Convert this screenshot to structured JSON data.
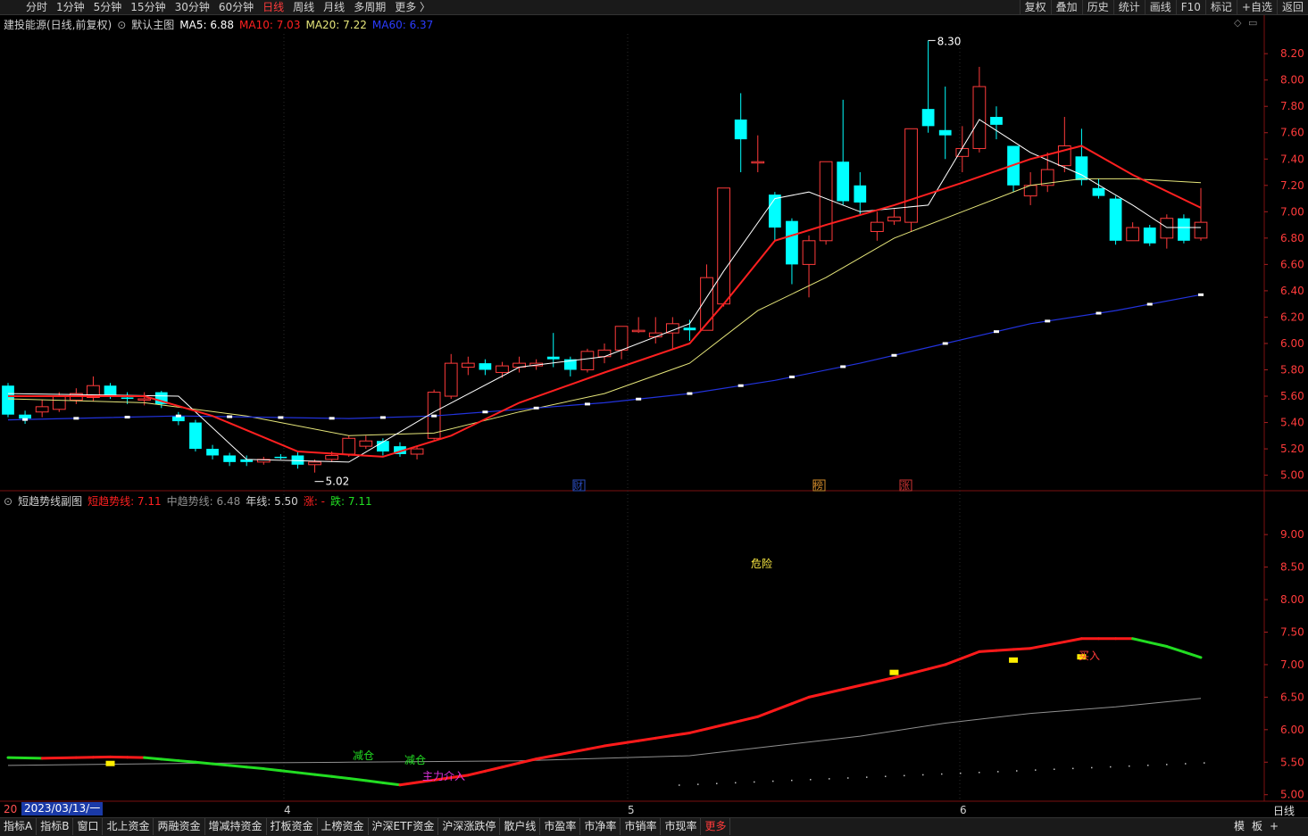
{
  "toolbar_left": [
    "分时",
    "1分钟",
    "5分钟",
    "15分钟",
    "30分钟",
    "60分钟",
    "日线",
    "周线",
    "月线",
    "多周期",
    "更多 〉"
  ],
  "toolbar_active": "日线",
  "toolbar_right": [
    "复权",
    "叠加",
    "历史",
    "统计",
    "画线",
    "F10",
    "标记",
    "+自选",
    "返回"
  ],
  "main": {
    "stock_title": "建投能源(日线,前复权)",
    "template": "默认主图",
    "ma5": "MA5: 6.88",
    "ma10": "MA10: 7.03",
    "ma20": "MA20: 7.22",
    "ma60": "MA60: 6.37",
    "y_ticks": [
      "8.20",
      "8.00",
      "7.80",
      "7.60",
      "7.40",
      "7.20",
      "7.00",
      "6.80",
      "6.60",
      "6.40",
      "6.20",
      "6.00",
      "5.80",
      "5.60",
      "5.40",
      "5.20",
      "5.00"
    ],
    "high_label": "8.30",
    "low_label": "5.02",
    "event_labels": [
      "财",
      "榜",
      "涨"
    ]
  },
  "sub": {
    "title": "短趋势线副图",
    "short_trend": "短趋势线: 7.11",
    "mid_trend": "中趋势线: 6.48",
    "year_line": "年线: 5.50",
    "up_label": "涨: -",
    "down_label": "跌: 7.11",
    "y_ticks": [
      "9.00",
      "8.50",
      "8.00",
      "7.50",
      "7.00",
      "6.50",
      "6.00",
      "5.50",
      "5.00"
    ],
    "annotations": [
      "危险",
      "减仓",
      "减仓",
      "主力介入",
      "买入"
    ]
  },
  "x_axis": {
    "date_box": "2023/03/13/一",
    "month_labels": [
      "4",
      "5",
      "6"
    ]
  },
  "bottom_tabs": [
    "指标A",
    "指标B",
    "窗口",
    "北上资金",
    "两融资金",
    "增减持资金",
    "打板资金",
    "上榜资金",
    "沪深ETF资金",
    "沪深涨跌停",
    "散户线",
    "市盈率",
    "市净率",
    "市销率",
    "市现率",
    "更多"
  ],
  "bottom_right": [
    "模",
    "板",
    "+"
  ],
  "period_label": "日线",
  "colors": {
    "up": "#ff3b3b",
    "down": "#00ffff",
    "ma5": "#ffffff",
    "ma10": "#ff2020",
    "ma20": "#e6e67a",
    "ma60": "#2233dd",
    "trend_up": "#ff1a1a",
    "trend_down": "#22dd22",
    "mid": "#909090"
  },
  "chart_data": {
    "type": "candlestick",
    "y_range": [
      4.95,
      8.35
    ],
    "candles": [
      [
        5.68,
        5.46,
        5.7,
        5.44
      ],
      [
        5.46,
        5.43,
        5.49,
        5.39
      ],
      [
        5.48,
        5.52,
        5.57,
        5.44
      ],
      [
        5.5,
        5.6,
        5.63,
        5.48
      ],
      [
        5.57,
        5.62,
        5.66,
        5.54
      ],
      [
        5.59,
        5.68,
        5.75,
        5.56
      ],
      [
        5.68,
        5.61,
        5.7,
        5.58
      ],
      [
        5.59,
        5.58,
        5.63,
        5.54
      ],
      [
        5.58,
        5.58,
        5.63,
        5.53
      ],
      [
        5.63,
        5.54,
        5.64,
        5.51
      ],
      [
        5.45,
        5.41,
        5.48,
        5.38
      ],
      [
        5.4,
        5.2,
        5.42,
        5.18
      ],
      [
        5.2,
        5.15,
        5.23,
        5.12
      ],
      [
        5.15,
        5.1,
        5.17,
        5.07
      ],
      [
        5.12,
        5.1,
        5.15,
        5.07
      ],
      [
        5.1,
        5.12,
        5.14,
        5.08
      ],
      [
        5.14,
        5.13,
        5.16,
        5.12
      ],
      [
        5.15,
        5.08,
        5.18,
        5.05
      ],
      [
        5.08,
        5.1,
        5.12,
        5.02
      ],
      [
        5.12,
        5.15,
        5.18,
        5.1
      ],
      [
        5.16,
        5.28,
        5.3,
        5.14
      ],
      [
        5.22,
        5.26,
        5.3,
        5.2
      ],
      [
        5.26,
        5.18,
        5.28,
        5.15
      ],
      [
        5.22,
        5.16,
        5.25,
        5.14
      ],
      [
        5.16,
        5.2,
        5.22,
        5.12
      ],
      [
        5.28,
        5.63,
        5.65,
        5.27
      ],
      [
        5.6,
        5.85,
        5.92,
        5.58
      ],
      [
        5.82,
        5.85,
        5.9,
        5.76
      ],
      [
        5.85,
        5.8,
        5.88,
        5.76
      ],
      [
        5.78,
        5.83,
        5.86,
        5.74
      ],
      [
        5.82,
        5.85,
        5.9,
        5.78
      ],
      [
        5.83,
        5.85,
        5.88,
        5.8
      ],
      [
        5.9,
        5.88,
        6.08,
        5.82
      ],
      [
        5.88,
        5.8,
        5.9,
        5.75
      ],
      [
        5.8,
        5.94,
        5.96,
        5.78
      ],
      [
        5.9,
        5.95,
        6.0,
        5.85
      ],
      [
        5.95,
        6.13,
        6.13,
        5.88
      ],
      [
        6.1,
        6.1,
        6.2,
        6.08
      ],
      [
        6.05,
        6.08,
        6.2,
        6.0
      ],
      [
        6.08,
        6.15,
        6.2,
        5.95
      ],
      [
        6.12,
        6.1,
        6.18,
        6.02
      ],
      [
        6.1,
        6.5,
        6.6,
        6.1
      ],
      [
        6.3,
        7.18,
        7.18,
        6.28
      ],
      [
        7.7,
        7.55,
        7.9,
        7.3
      ],
      [
        7.38,
        7.38,
        7.58,
        7.3
      ],
      [
        7.13,
        6.88,
        7.15,
        6.78
      ],
      [
        6.93,
        6.6,
        6.95,
        6.45
      ],
      [
        6.6,
        6.78,
        6.82,
        6.35
      ],
      [
        6.78,
        7.38,
        7.38,
        6.75
      ],
      [
        7.38,
        7.08,
        7.85,
        7.05
      ],
      [
        7.2,
        7.07,
        7.3,
        6.98
      ],
      [
        6.85,
        6.92,
        7.0,
        6.78
      ],
      [
        6.93,
        6.96,
        7.02,
        6.9
      ],
      [
        6.92,
        7.63,
        7.63,
        6.85
      ],
      [
        7.78,
        7.65,
        8.3,
        7.6
      ],
      [
        7.62,
        7.58,
        7.95,
        7.4
      ],
      [
        7.42,
        7.48,
        7.65,
        7.3
      ],
      [
        7.48,
        7.95,
        8.1,
        7.45
      ],
      [
        7.72,
        7.66,
        7.8,
        7.55
      ],
      [
        7.5,
        7.2,
        7.5,
        7.15
      ],
      [
        7.12,
        7.2,
        7.3,
        7.05
      ],
      [
        7.2,
        7.32,
        7.45,
        7.15
      ],
      [
        7.35,
        7.5,
        7.72,
        7.3
      ],
      [
        7.42,
        7.24,
        7.63,
        7.2
      ],
      [
        7.18,
        7.12,
        7.25,
        7.1
      ],
      [
        7.1,
        6.78,
        7.12,
        6.75
      ],
      [
        6.78,
        6.88,
        6.92,
        6.78
      ],
      [
        6.88,
        6.76,
        6.9,
        6.74
      ],
      [
        6.8,
        6.95,
        6.98,
        6.72
      ],
      [
        6.95,
        6.78,
        6.98,
        6.76
      ],
      [
        6.8,
        6.92,
        7.18,
        6.78
      ]
    ],
    "ma5": [
      [
        0,
        5.62
      ],
      [
        10,
        5.6
      ],
      [
        14,
        5.12
      ],
      [
        20,
        5.1
      ],
      [
        25,
        5.48
      ],
      [
        30,
        5.82
      ],
      [
        35,
        5.9
      ],
      [
        40,
        6.15
      ],
      [
        42,
        6.55
      ],
      [
        45,
        7.1
      ],
      [
        47,
        7.15
      ],
      [
        50,
        7.0
      ],
      [
        54,
        7.05
      ],
      [
        57,
        7.7
      ],
      [
        60,
        7.45
      ],
      [
        63,
        7.28
      ],
      [
        66,
        7.05
      ],
      [
        68,
        6.88
      ],
      [
        70,
        6.88
      ]
    ],
    "ma10": [
      [
        0,
        5.6
      ],
      [
        8,
        5.6
      ],
      [
        12,
        5.45
      ],
      [
        17,
        5.18
      ],
      [
        22,
        5.14
      ],
      [
        26,
        5.3
      ],
      [
        30,
        5.55
      ],
      [
        35,
        5.78
      ],
      [
        40,
        6.0
      ],
      [
        42,
        6.3
      ],
      [
        45,
        6.78
      ],
      [
        48,
        6.9
      ],
      [
        52,
        7.05
      ],
      [
        56,
        7.22
      ],
      [
        60,
        7.4
      ],
      [
        63,
        7.5
      ],
      [
        66,
        7.28
      ],
      [
        70,
        7.03
      ]
    ],
    "ma20": [
      [
        0,
        5.58
      ],
      [
        8,
        5.55
      ],
      [
        14,
        5.45
      ],
      [
        20,
        5.3
      ],
      [
        25,
        5.32
      ],
      [
        30,
        5.48
      ],
      [
        35,
        5.62
      ],
      [
        40,
        5.85
      ],
      [
        44,
        6.25
      ],
      [
        48,
        6.5
      ],
      [
        52,
        6.8
      ],
      [
        56,
        7.0
      ],
      [
        60,
        7.2
      ],
      [
        63,
        7.25
      ],
      [
        66,
        7.25
      ],
      [
        70,
        7.22
      ]
    ],
    "ma60": [
      [
        0,
        5.42
      ],
      [
        10,
        5.45
      ],
      [
        20,
        5.43
      ],
      [
        25,
        5.45
      ],
      [
        30,
        5.5
      ],
      [
        35,
        5.55
      ],
      [
        40,
        5.62
      ],
      [
        45,
        5.72
      ],
      [
        50,
        5.85
      ],
      [
        55,
        6.0
      ],
      [
        60,
        6.15
      ],
      [
        65,
        6.25
      ],
      [
        70,
        6.37
      ]
    ],
    "sub_y_range": [
      4.9,
      9.4
    ],
    "short_trend": [
      [
        0,
        5.57
      ],
      [
        2,
        5.56
      ],
      [
        6,
        5.58
      ],
      [
        8,
        5.57
      ],
      [
        11,
        5.5
      ],
      [
        15,
        5.4
      ],
      [
        20,
        5.25
      ],
      [
        23,
        5.15
      ],
      [
        27,
        5.3
      ],
      [
        31,
        5.55
      ],
      [
        35,
        5.75
      ],
      [
        40,
        5.95
      ],
      [
        44,
        6.2
      ],
      [
        47,
        6.5
      ],
      [
        52,
        6.8
      ],
      [
        55,
        7.0
      ],
      [
        57,
        7.2
      ],
      [
        60,
        7.25
      ],
      [
        63,
        7.4
      ],
      [
        66,
        7.4
      ],
      [
        68,
        7.28
      ],
      [
        70,
        7.11
      ]
    ],
    "short_trend_down_ranges": [
      [
        0,
        2
      ],
      [
        8,
        23
      ],
      [
        66,
        70
      ]
    ],
    "mid_trend": [
      [
        0,
        5.45
      ],
      [
        10,
        5.48
      ],
      [
        20,
        5.5
      ],
      [
        30,
        5.52
      ],
      [
        40,
        5.6
      ],
      [
        45,
        5.75
      ],
      [
        50,
        5.9
      ],
      [
        55,
        6.1
      ],
      [
        60,
        6.25
      ],
      [
        65,
        6.35
      ],
      [
        70,
        6.48
      ]
    ]
  }
}
